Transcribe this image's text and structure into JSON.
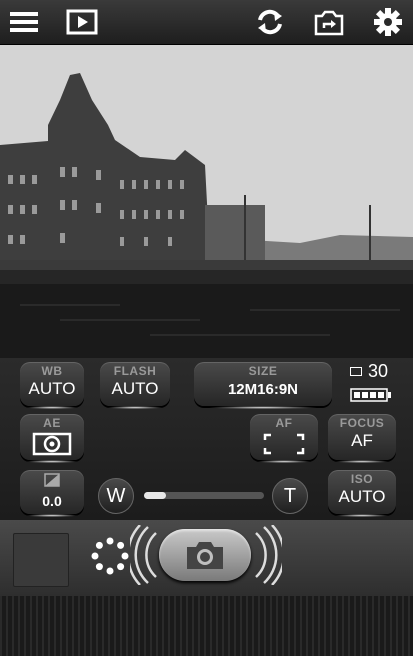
{
  "toolbar": {
    "icons": [
      "menu-icon",
      "playback-icon",
      "switch-camera-icon",
      "share-camera-icon",
      "settings-icon"
    ]
  },
  "controls": {
    "wb": {
      "label": "WB",
      "value": "AUTO"
    },
    "flash": {
      "label": "FLASH",
      "value": "AUTO"
    },
    "size": {
      "label": "SIZE",
      "value": "12M16:9N"
    },
    "shots_remaining": "30",
    "ae": {
      "label": "AE",
      "icon": "metering-icon"
    },
    "af": {
      "label": "AF",
      "icon": "af-frame-icon"
    },
    "focus": {
      "label": "FOCUS",
      "value": "AF"
    },
    "ev": {
      "icon": "exposure-icon",
      "value": "0.0"
    },
    "zoom": {
      "wide": "W",
      "tele": "T",
      "level": 0.18
    },
    "iso": {
      "label": "ISO",
      "value": "AUTO"
    }
  },
  "bottom": {
    "icons": [
      "last-photo-thumbnail",
      "mode-dots-icon",
      "shutter-camera-icon"
    ]
  },
  "colors": {
    "accent": "#ffffff",
    "panel": "#2b2b2b",
    "label": "#9a9a9a"
  }
}
